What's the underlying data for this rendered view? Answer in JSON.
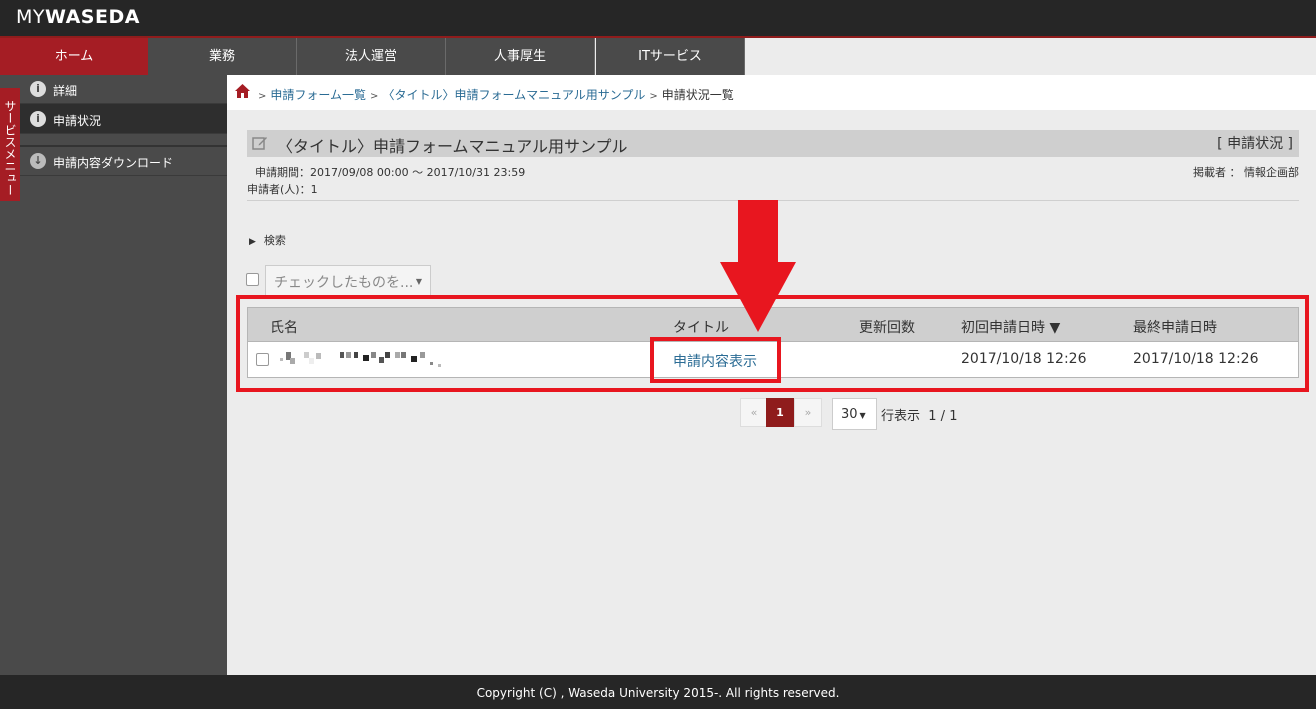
{
  "header": {
    "logo_my": "MY",
    "logo_waseda": "WASEDA"
  },
  "nav": {
    "tabs": [
      {
        "label": "ホーム",
        "active": true
      },
      {
        "label": "業務"
      },
      {
        "label": "法人運営"
      },
      {
        "label": "人事厚生"
      },
      {
        "label": "ITサービス"
      }
    ]
  },
  "sidebar": {
    "service_menu": "サービスメニュー",
    "items": [
      {
        "label": "詳細",
        "icon": "info-icon"
      },
      {
        "label": "申請状況",
        "icon": "info-icon",
        "selected": true
      },
      {
        "label": "申請内容ダウンロード",
        "icon": "download-icon"
      }
    ]
  },
  "breadcrumb": {
    "items": [
      "申請フォーム一覧",
      "〈タイトル〉申請フォームマニュアル用サンプル"
    ],
    "current": "申請状況一覧",
    "separator": ">"
  },
  "form": {
    "title": "〈タイトル〉申請フォームマニュアル用サンプル",
    "status_label": "[ 申請状況 ]",
    "period": "申請期間：2017/09/08 00:00 ～ 2017/10/31 23:59",
    "publisher": "掲載者 ： 情報企画部",
    "applicants": "申請者(人)：1"
  },
  "search": {
    "label": "検索"
  },
  "bulk": {
    "placeholder": "チェックしたものを..."
  },
  "table": {
    "columns": [
      "氏名",
      "タイトル",
      "更新回数",
      "初回申請日時 ▼",
      "最終申請日時"
    ],
    "rows": [
      {
        "name": "",
        "title": "申請内容表示",
        "updates": "",
        "first": "2017/10/18 12:26",
        "last": "2017/10/18 12:26"
      }
    ]
  },
  "pagination": {
    "prev": "«",
    "current": "1",
    "next": "»",
    "per_page": "30",
    "rows_label": "行表示",
    "page_info": "1 / 1"
  },
  "footer": {
    "copyright": "Copyright (C) , Waseda University 2015-. All rights reserved."
  },
  "colors": {
    "accent": "#a51d24",
    "annotation": "#e8161f",
    "link": "#2a6b94"
  }
}
